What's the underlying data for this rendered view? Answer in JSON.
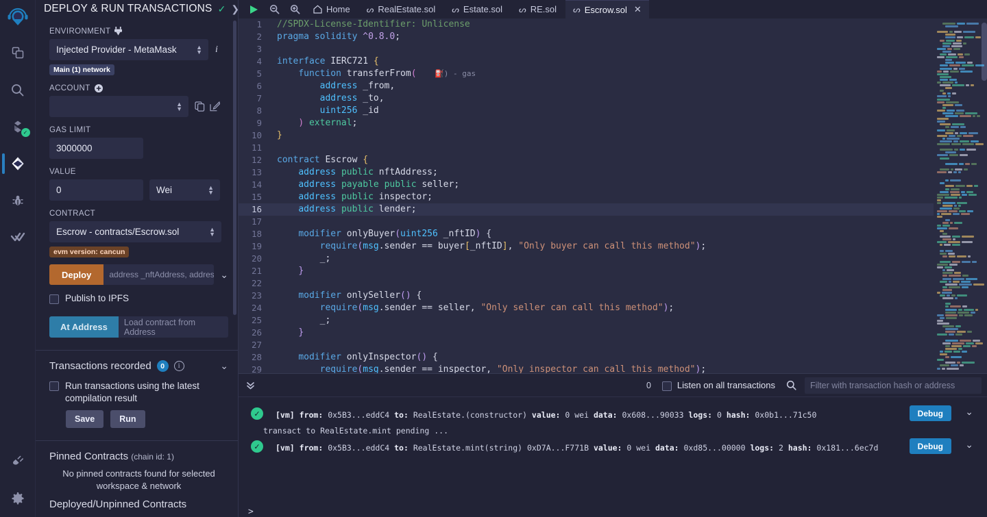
{
  "rail": {
    "logo": "remix-logo",
    "items": [
      {
        "name": "file-explorer-icon",
        "label": "File explorer"
      },
      {
        "name": "search-icon",
        "label": "Search in files"
      },
      {
        "name": "solidity-compiler-icon",
        "label": "Solidity compiler"
      },
      {
        "name": "deploy-run-icon",
        "label": "Deploy & run transactions",
        "active": true
      },
      {
        "name": "debugger-icon",
        "label": "Debugger"
      },
      {
        "name": "solidity-unit-testing-icon",
        "label": "Solidity unit testing"
      }
    ],
    "bottom": [
      {
        "name": "plugin-manager-icon",
        "label": "Plugin manager"
      },
      {
        "name": "settings-gear-icon",
        "label": "Settings"
      }
    ]
  },
  "panel": {
    "title": "DEPLOY & RUN TRANSACTIONS",
    "header_check_icon": "check-icon",
    "header_chevron_icon": "chevron-right-icon",
    "environment": {
      "label": "ENVIRONMENT",
      "plug_icon": "plug-icon",
      "value": "Injected Provider - MetaMask",
      "info_icon": "info-icon",
      "network_badge": "Main (1) network"
    },
    "account": {
      "label": "ACCOUNT",
      "add_icon": "plus-circle-icon",
      "value": "",
      "copy_icon": "copy-icon",
      "edit_icon": "edit-icon"
    },
    "gas_limit": {
      "label": "GAS LIMIT",
      "value": "3000000"
    },
    "value_field": {
      "label": "VALUE",
      "value": "0",
      "unit": "Wei"
    },
    "contract": {
      "label": "CONTRACT",
      "value": "Escrow - contracts/Escrow.sol",
      "evm_badge": "evm version: cancun"
    },
    "deploy": {
      "button": "Deploy",
      "args_placeholder": "address _nftAddress, address _se",
      "chevron_icon": "chevron-down-icon",
      "publish_ipfs": "Publish to IPFS"
    },
    "at_address": {
      "button": "At Address",
      "placeholder": "Load contract from Address"
    },
    "transactions_recorded": {
      "title": "Transactions recorded",
      "count": "0",
      "info_icon": "info-icon",
      "chevron_icon": "chevron-down-icon",
      "checkbox_label": "Run transactions using the latest compilation result",
      "save_button": "Save",
      "run_button": "Run"
    },
    "pinned": {
      "title": "Pinned Contracts",
      "chain": "(chain id: 1)",
      "empty": "No pinned contracts found for selected workspace & network"
    },
    "deployed_title": "Deployed/Unpinned Contracts"
  },
  "tabbar": {
    "icons": [
      {
        "name": "run-icon",
        "glyph": "▶"
      },
      {
        "name": "zoom-out-icon",
        "glyph": "zoom-out"
      },
      {
        "name": "zoom-in-icon",
        "glyph": "zoom-in"
      }
    ],
    "home_tab": "Home",
    "tabs": [
      {
        "label": "RealEstate.sol",
        "active": false
      },
      {
        "label": "Estate.sol",
        "active": false
      },
      {
        "label": "RE.sol",
        "active": false
      },
      {
        "label": "Escrow.sol",
        "active": true,
        "close_icon": "close-icon"
      }
    ]
  },
  "editor": {
    "gas_hint": "⛽) - gas",
    "current_line": 16,
    "lines": [
      {
        "n": 1,
        "tokens": [
          {
            "t": "//SPDX-License-Identifier: Unlicense",
            "c": "cmt"
          }
        ]
      },
      {
        "n": 2,
        "tokens": [
          {
            "t": "pragma",
            "c": "kw"
          },
          {
            "t": " ",
            "c": "pl"
          },
          {
            "t": "solidity",
            "c": "kw"
          },
          {
            "t": " ",
            "c": "pl"
          },
          {
            "t": "^0.8.0",
            "c": "num"
          },
          {
            "t": ";",
            "c": "pl"
          }
        ]
      },
      {
        "n": 3,
        "tokens": []
      },
      {
        "n": 4,
        "tokens": [
          {
            "t": "interface",
            "c": "kw"
          },
          {
            "t": " ",
            "c": "pl"
          },
          {
            "t": "IERC721",
            "c": "pl"
          },
          {
            "t": " ",
            "c": "pl"
          },
          {
            "t": "{",
            "c": "brc"
          }
        ]
      },
      {
        "n": 5,
        "tokens": [
          {
            "t": "    ",
            "c": "pl"
          },
          {
            "t": "function",
            "c": "kw"
          },
          {
            "t": " ",
            "c": "pl"
          },
          {
            "t": "transferFrom",
            "c": "pl"
          },
          {
            "t": "(",
            "c": "brc2"
          }
        ]
      },
      {
        "n": 6,
        "tokens": [
          {
            "t": "        ",
            "c": "pl"
          },
          {
            "t": "address",
            "c": "typ"
          },
          {
            "t": " _from,",
            "c": "pl"
          }
        ]
      },
      {
        "n": 7,
        "tokens": [
          {
            "t": "        ",
            "c": "pl"
          },
          {
            "t": "address",
            "c": "typ"
          },
          {
            "t": " _to,",
            "c": "pl"
          }
        ]
      },
      {
        "n": 8,
        "tokens": [
          {
            "t": "        ",
            "c": "pl"
          },
          {
            "t": "uint256",
            "c": "typ"
          },
          {
            "t": " _id",
            "c": "pl"
          }
        ]
      },
      {
        "n": 9,
        "tokens": [
          {
            "t": "    ",
            "c": "pl"
          },
          {
            "t": ")",
            "c": "brc2"
          },
          {
            "t": " ",
            "c": "pl"
          },
          {
            "t": "external",
            "c": "grn"
          },
          {
            "t": ";",
            "c": "pl"
          }
        ]
      },
      {
        "n": 10,
        "tokens": [
          {
            "t": "}",
            "c": "brc"
          }
        ]
      },
      {
        "n": 11,
        "tokens": []
      },
      {
        "n": 12,
        "tokens": [
          {
            "t": "contract",
            "c": "kw"
          },
          {
            "t": " ",
            "c": "pl"
          },
          {
            "t": "Escrow",
            "c": "pl"
          },
          {
            "t": " ",
            "c": "pl"
          },
          {
            "t": "{",
            "c": "brc"
          }
        ]
      },
      {
        "n": 13,
        "tokens": [
          {
            "t": "    ",
            "c": "pl"
          },
          {
            "t": "address",
            "c": "typ"
          },
          {
            "t": " ",
            "c": "pl"
          },
          {
            "t": "public",
            "c": "grn"
          },
          {
            "t": " nftAddress;",
            "c": "pl"
          }
        ]
      },
      {
        "n": 14,
        "tokens": [
          {
            "t": "    ",
            "c": "pl"
          },
          {
            "t": "address",
            "c": "typ"
          },
          {
            "t": " ",
            "c": "pl"
          },
          {
            "t": "payable",
            "c": "grn"
          },
          {
            "t": " ",
            "c": "pl"
          },
          {
            "t": "public",
            "c": "grn"
          },
          {
            "t": " seller;",
            "c": "pl"
          }
        ]
      },
      {
        "n": 15,
        "tokens": [
          {
            "t": "    ",
            "c": "pl"
          },
          {
            "t": "address",
            "c": "typ"
          },
          {
            "t": " ",
            "c": "pl"
          },
          {
            "t": "public",
            "c": "grn"
          },
          {
            "t": " inspector;",
            "c": "pl"
          }
        ]
      },
      {
        "n": 16,
        "tokens": [
          {
            "t": "    ",
            "c": "pl"
          },
          {
            "t": "address",
            "c": "typ"
          },
          {
            "t": " ",
            "c": "pl"
          },
          {
            "t": "public",
            "c": "grn"
          },
          {
            "t": " lender;",
            "c": "pl"
          }
        ]
      },
      {
        "n": 17,
        "tokens": []
      },
      {
        "n": 18,
        "tokens": [
          {
            "t": "    ",
            "c": "pl"
          },
          {
            "t": "modifier",
            "c": "kw"
          },
          {
            "t": " onlyBuyer",
            "c": "pl"
          },
          {
            "t": "(",
            "c": "brc3"
          },
          {
            "t": "uint256",
            "c": "typ"
          },
          {
            "t": " _nftID",
            "c": "pl"
          },
          {
            "t": ")",
            "c": "brc3"
          },
          {
            "t": " {",
            "c": "pl"
          }
        ]
      },
      {
        "n": 19,
        "tokens": [
          {
            "t": "        ",
            "c": "pl"
          },
          {
            "t": "require",
            "c": "fn"
          },
          {
            "t": "(",
            "c": "brc3"
          },
          {
            "t": "msg",
            "c": "typ"
          },
          {
            "t": ".sender == buyer",
            "c": "pl"
          },
          {
            "t": "[",
            "c": "brc"
          },
          {
            "t": "_nftID",
            "c": "pl"
          },
          {
            "t": "]",
            "c": "brc"
          },
          {
            "t": ", ",
            "c": "pl"
          },
          {
            "t": "\"Only buyer can call this method\"",
            "c": "str"
          },
          {
            "t": ")",
            "c": "brc3"
          },
          {
            "t": ";",
            "c": "pl"
          }
        ]
      },
      {
        "n": 20,
        "tokens": [
          {
            "t": "        _;",
            "c": "pl"
          }
        ]
      },
      {
        "n": 21,
        "tokens": [
          {
            "t": "    ",
            "c": "pl"
          },
          {
            "t": "}",
            "c": "brc3"
          }
        ]
      },
      {
        "n": 22,
        "tokens": []
      },
      {
        "n": 23,
        "tokens": [
          {
            "t": "    ",
            "c": "pl"
          },
          {
            "t": "modifier",
            "c": "kw"
          },
          {
            "t": " onlySeller",
            "c": "pl"
          },
          {
            "t": "(",
            "c": "brc3"
          },
          {
            "t": ")",
            "c": "brc3"
          },
          {
            "t": " {",
            "c": "pl"
          }
        ]
      },
      {
        "n": 24,
        "tokens": [
          {
            "t": "        ",
            "c": "pl"
          },
          {
            "t": "require",
            "c": "fn"
          },
          {
            "t": "(",
            "c": "brc3"
          },
          {
            "t": "msg",
            "c": "typ"
          },
          {
            "t": ".sender == seller, ",
            "c": "pl"
          },
          {
            "t": "\"Only seller can call this method\"",
            "c": "str"
          },
          {
            "t": ")",
            "c": "brc3"
          },
          {
            "t": ";",
            "c": "pl"
          }
        ]
      },
      {
        "n": 25,
        "tokens": [
          {
            "t": "        _;",
            "c": "pl"
          }
        ]
      },
      {
        "n": 26,
        "tokens": [
          {
            "t": "    ",
            "c": "pl"
          },
          {
            "t": "}",
            "c": "brc3"
          }
        ]
      },
      {
        "n": 27,
        "tokens": []
      },
      {
        "n": 28,
        "tokens": [
          {
            "t": "    ",
            "c": "pl"
          },
          {
            "t": "modifier",
            "c": "kw"
          },
          {
            "t": " onlyInspector",
            "c": "pl"
          },
          {
            "t": "(",
            "c": "brc3"
          },
          {
            "t": ")",
            "c": "brc3"
          },
          {
            "t": " {",
            "c": "pl"
          }
        ]
      },
      {
        "n": 29,
        "tokens": [
          {
            "t": "        ",
            "c": "pl"
          },
          {
            "t": "require",
            "c": "fn"
          },
          {
            "t": "(",
            "c": "brc3"
          },
          {
            "t": "msg",
            "c": "typ"
          },
          {
            "t": ".sender == inspector, ",
            "c": "pl"
          },
          {
            "t": "\"Only inspector can call this method\"",
            "c": "str"
          },
          {
            "t": ")",
            "c": "brc3"
          },
          {
            "t": ";",
            "c": "pl"
          }
        ]
      }
    ]
  },
  "terminal": {
    "chevrons_icon": "chevron-double-down-icon",
    "pending_count": "0",
    "listen_label": "Listen on all transactions",
    "search_icon": "search-icon",
    "filter_placeholder": "Filter with transaction hash or address",
    "prompt": ">",
    "logs": [
      {
        "status_icon": "check-circle-icon",
        "parts": [
          {
            "t": "[vm]",
            "b": true
          },
          {
            "t": "  "
          },
          {
            "t": "from:",
            "b": true
          },
          {
            "t": " 0x5B3...eddC4 "
          },
          {
            "t": "to:",
            "b": true
          },
          {
            "t": " RealEstate.(constructor) "
          },
          {
            "t": "value:",
            "b": true
          },
          {
            "t": " 0 wei "
          },
          {
            "t": "data:",
            "b": true
          },
          {
            "t": " 0x608...90033 "
          },
          {
            "t": "logs:",
            "b": true
          },
          {
            "t": " 0 "
          },
          {
            "t": "hash:",
            "b": true
          },
          {
            "t": " 0x0b1...71c50"
          }
        ],
        "sub": "transact to RealEstate.mint pending ... ",
        "debug_button": "Debug",
        "chevron_icon": "chevron-down-icon"
      },
      {
        "status_icon": "check-circle-icon",
        "parts": [
          {
            "t": "[vm]",
            "b": true
          },
          {
            "t": "  "
          },
          {
            "t": "from:",
            "b": true
          },
          {
            "t": " 0x5B3...eddC4 "
          },
          {
            "t": "to:",
            "b": true
          },
          {
            "t": " RealEstate.mint(string) 0xD7A...F771B "
          },
          {
            "t": "value:",
            "b": true
          },
          {
            "t": " 0 wei "
          },
          {
            "t": "data:",
            "b": true
          },
          {
            "t": " 0xd85...00000 "
          },
          {
            "t": "logs:",
            "b": true
          },
          {
            "t": " 2 "
          },
          {
            "t": "hash:",
            "b": true
          },
          {
            "t": " 0x181...6ec7d"
          }
        ],
        "sub": "",
        "debug_button": "Debug",
        "chevron_icon": "chevron-down-icon"
      }
    ]
  },
  "colors": {
    "bg": "#222336",
    "editor_bg": "#2a2c42",
    "accent_blue": "#1f7fbf",
    "deploy_orange": "#b3682e",
    "at_address_blue": "#2e7da8",
    "success_green": "#2fc98e"
  }
}
